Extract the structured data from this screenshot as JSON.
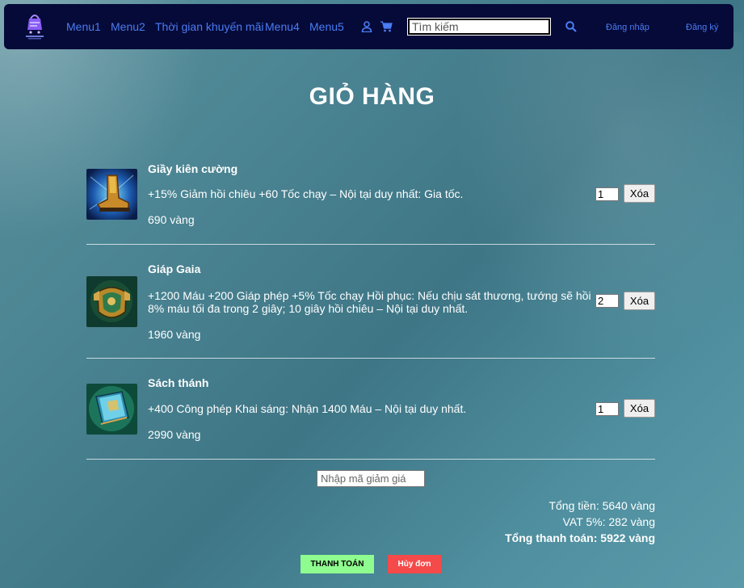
{
  "nav": {
    "logo_name": "shop-logo",
    "menu": [
      "Menu1",
      "Menu2",
      "Thời gian khuyến mãi",
      "Menu4",
      "Menu5"
    ],
    "search_placeholder": "Tìm kiếm",
    "login": "Đăng nhập",
    "register": "Đăng ký",
    "icons": [
      "user-icon",
      "cart-icon",
      "search-icon"
    ],
    "link_color": "#4a7cf2",
    "bg_color": "#060a38"
  },
  "page": {
    "title": "GIỎ HÀNG"
  },
  "cart": {
    "items": [
      {
        "name": "Giầy kiên cường",
        "desc": "+15% Giảm hồi chiêu +60 Tốc chạy – Nội tại duy nhất: Gia tốc.",
        "price": "690 vàng",
        "qty": "1",
        "delete_label": "Xóa",
        "image": "boots-item"
      },
      {
        "name": "Giáp Gaia",
        "desc": "+1200 Máu +200 Giáp phép +5% Tốc chạy Hồi phục: Nếu chịu sát thương, tướng sẽ hồi 8% máu tối đa trong 2 giây; 10 giây hồi chiêu – Nội tại duy nhất.",
        "price": "1960 vàng",
        "qty": "2",
        "delete_label": "Xóa",
        "image": "armor-item"
      },
      {
        "name": "Sách thánh",
        "desc": "+400 Công phép Khai sáng: Nhận 1400 Máu – Nội tại duy nhất.",
        "price": "2990 vàng",
        "qty": "1",
        "delete_label": "Xóa",
        "image": "book-item"
      }
    ]
  },
  "coupon": {
    "placeholder": "Nhập mã giảm giá"
  },
  "summary": {
    "subtotal": "Tổng tiền: 5640 vàng",
    "vat": "VAT 5%: 282 vàng",
    "total": "Tổng thanh toán: 5922 vàng"
  },
  "actions": {
    "pay": "THANH TOÁN",
    "cancel": "Hủy đơn",
    "pay_color": "#8ffc8f",
    "cancel_color": "#f44a4a"
  }
}
